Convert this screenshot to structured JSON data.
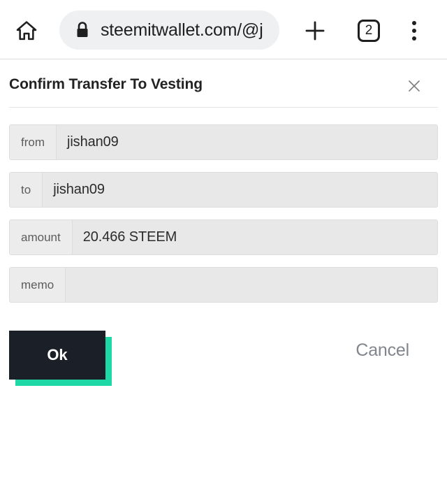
{
  "browser": {
    "home_icon": "home-icon",
    "lock_icon": "lock-icon",
    "url": "steemitwallet.com/@j",
    "new_tab_icon": "plus-icon",
    "tab_count": "2",
    "menu_icon": "overflow-menu-icon"
  },
  "modal": {
    "title": "Confirm Transfer To Vesting",
    "close_icon": "close-icon",
    "fields": [
      {
        "label": "from",
        "value": "jishan09"
      },
      {
        "label": "to",
        "value": "jishan09"
      },
      {
        "label": "amount",
        "value": "20.466 STEEM"
      },
      {
        "label": "memo",
        "value": ""
      }
    ],
    "confirm_label": "Ok",
    "cancel_label": "Cancel"
  },
  "colors": {
    "accent_teal": "#1ED8A5",
    "button_dark": "#1B2028",
    "field_bg": "#E8E8E8",
    "field_label_bg": "#ECECEC",
    "url_pill_bg": "#EFF0F2",
    "cancel_text": "#81868D"
  }
}
